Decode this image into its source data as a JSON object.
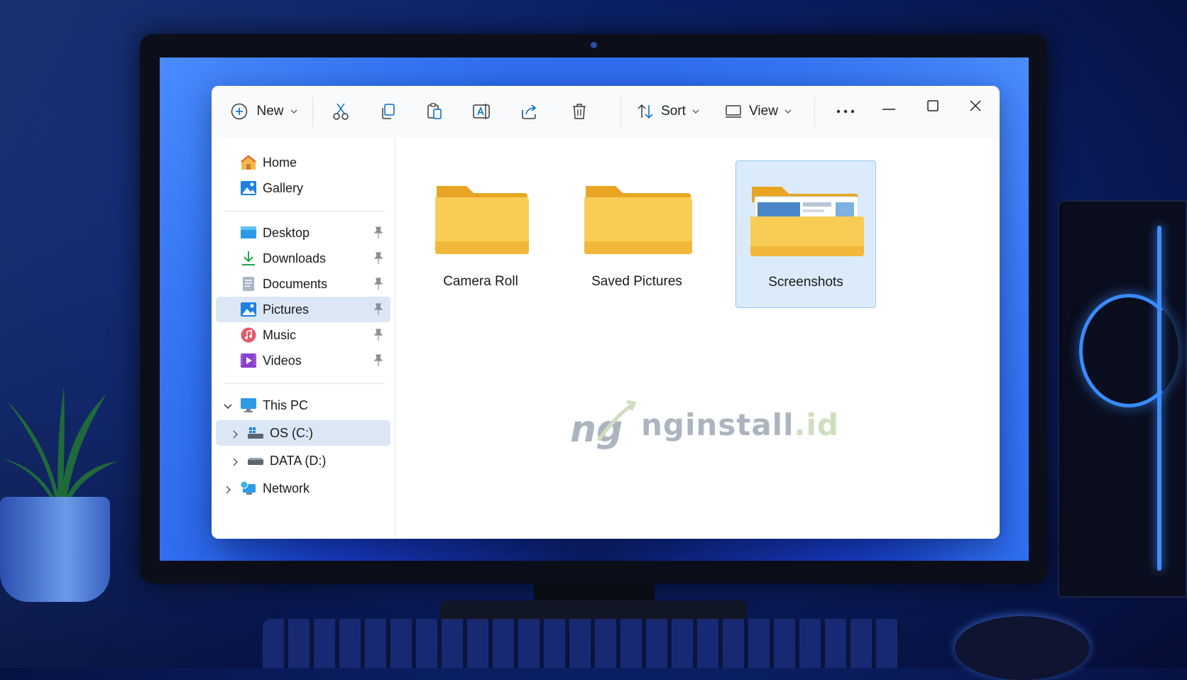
{
  "toolbar": {
    "new_label": "New",
    "sort_label": "Sort",
    "view_label": "View",
    "icons": [
      "plus-circle-icon",
      "cut-icon",
      "copy-icon",
      "paste-icon",
      "rename-icon",
      "share-icon",
      "delete-icon",
      "sort-icon",
      "view-icon",
      "more-icon"
    ]
  },
  "sidebar": {
    "quick": [
      {
        "label": "Home",
        "icon": "home-icon"
      },
      {
        "label": "Gallery",
        "icon": "gallery-icon"
      }
    ],
    "pinned": [
      {
        "label": "Desktop",
        "icon": "desktop-icon",
        "pinned": true
      },
      {
        "label": "Downloads",
        "icon": "downloads-icon",
        "pinned": true
      },
      {
        "label": "Documents",
        "icon": "documents-icon",
        "pinned": true
      },
      {
        "label": "Pictures",
        "icon": "pictures-icon",
        "pinned": true,
        "selected": true
      },
      {
        "label": "Music",
        "icon": "music-icon",
        "pinned": true
      },
      {
        "label": "Videos",
        "icon": "videos-icon",
        "pinned": true
      }
    ],
    "tree": [
      {
        "label": "This PC",
        "icon": "this-pc-icon",
        "expanded": true
      },
      {
        "label": "OS (C:)",
        "icon": "os-drive-icon",
        "selected": true
      },
      {
        "label": "DATA (D:)",
        "icon": "data-drive-icon"
      },
      {
        "label": "Network",
        "icon": "network-icon"
      }
    ]
  },
  "folders": [
    {
      "name": "Camera Roll",
      "selected": false
    },
    {
      "name": "Saved Pictures",
      "selected": false
    },
    {
      "name": "Screenshots",
      "selected": true
    }
  ],
  "watermark": {
    "mark": "ng",
    "name": "nginstall",
    "tld": ".id"
  },
  "colors": {
    "accent": "#0067c0",
    "selection": "#dcebfb",
    "folder": "#f7c948"
  }
}
